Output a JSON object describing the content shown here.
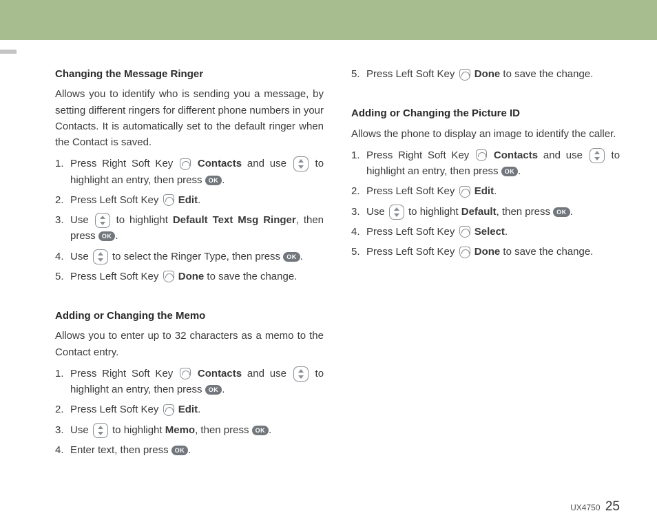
{
  "labels": {
    "ok": "OK",
    "contacts": "Contacts",
    "edit": "Edit",
    "done": "Done",
    "select": "Select",
    "default": "Default",
    "memo": "Memo",
    "defaultTextMsgRinger": "Default Text Msg Ringer"
  },
  "sectionA": {
    "heading": "Changing the Message Ringer",
    "desc": "Allows you to identify who is sending you a message, by setting different ringers for different phone numbers in your Contacts. It is automatically set to the default ringer when the Contact is saved.",
    "step1a": "Press Right Soft Key ",
    "step1b": " and use ",
    "step1c": " to highlight an entry, then press ",
    "step2a": "Press Left Soft Key ",
    "step3a": "Use ",
    "step3b": " to highlight ",
    "step3c": ", then press ",
    "step4a": "Use ",
    "step4b": " to select the Ringer Type, then press ",
    "step5a": "Press Left Soft Key ",
    "step5b": " to save the change."
  },
  "sectionB": {
    "heading": "Adding or Changing the Memo",
    "desc": "Allows you to enter up to 32 characters as a memo to the Contact entry.",
    "step1a": "Press Right Soft Key ",
    "step1b": " and use ",
    "step1c": " to highlight an entry, then press ",
    "step2a": "Press Left Soft Key ",
    "step3a": "Use ",
    "step3b": " to highlight ",
    "step3c": ", then press ",
    "step4a": "Enter text, then press "
  },
  "sectionC": {
    "step5a": "Press Left Soft Key ",
    "step5b": " to save the change."
  },
  "sectionD": {
    "heading": "Adding or Changing the Picture ID",
    "desc": "Allows the phone to display an image to identify the caller.",
    "step1a": "Press Right Soft Key ",
    "step1b": " and use ",
    "step1c": " to highlight an entry, then press ",
    "step2a": "Press Left Soft Key ",
    "step3a": "Use ",
    "step3b": " to highlight ",
    "step3c": ", then press ",
    "step4a": "Press Left Soft Key ",
    "step5a": "Press Left Soft Key ",
    "step5b": " to save the change."
  },
  "footer": {
    "model": "UX4750",
    "page": "25"
  }
}
